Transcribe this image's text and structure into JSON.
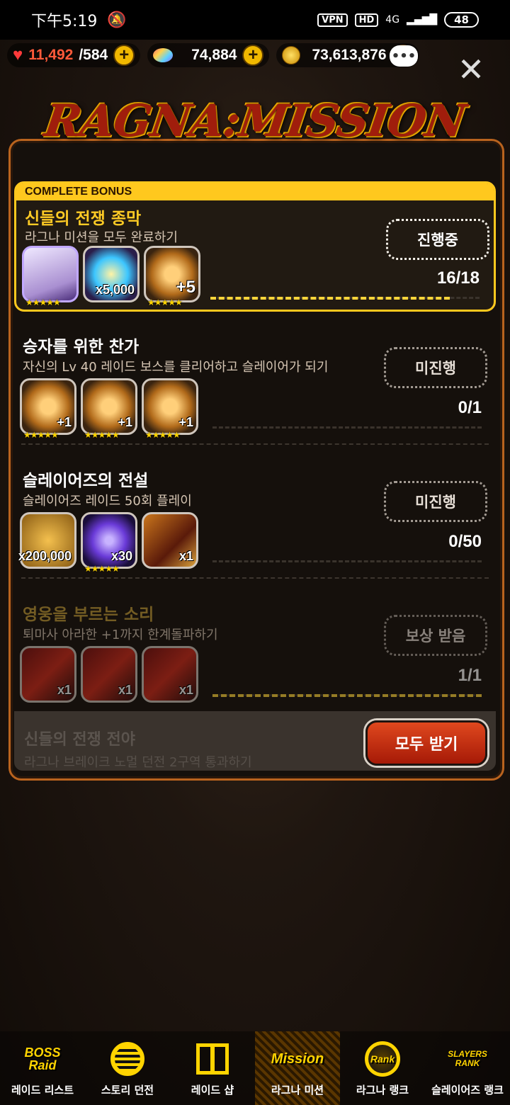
{
  "status_bar": {
    "time": "下午5:19",
    "vpn": "VPN",
    "hd": "HD",
    "network": "4G",
    "battery": "48"
  },
  "currencies": {
    "stamina": "11,492",
    "stamina_max": "/584",
    "gems": "74,884",
    "gold": "73,613,876"
  },
  "header": {
    "logo_text": "RAGNA:MISSION"
  },
  "bonus": {
    "header": "COMPLETE BONUS",
    "title": "신들의 전쟁 종막",
    "desc": "라그나 미션을 모두 완료하기",
    "state": "진행중",
    "progress_text": "16/18",
    "progress": 0.89,
    "rewards": [
      {
        "type": "character-card",
        "qty": "",
        "stars": "★★★★★"
      },
      {
        "type": "rainbow-gem",
        "qty": "x5,000",
        "stars": ""
      },
      {
        "type": "bronze-medal",
        "qty": "+5",
        "stars": "★★★★★"
      }
    ]
  },
  "missions": [
    {
      "title": "승자를 위한 찬가",
      "desc": "자신의 Lv 40 레이드 보스를 클리어하고 슬레이어가 되기",
      "state": "미진행",
      "progress_text": "0/1",
      "progress": 0,
      "rewards": [
        {
          "type": "bronze-medal",
          "qty": "+1",
          "stars": "★★★★★"
        },
        {
          "type": "bronze-medal",
          "qty": "+1",
          "stars": "★★★★★"
        },
        {
          "type": "bronze-medal",
          "qty": "+1",
          "stars": "★★★★★"
        }
      ]
    },
    {
      "title": "슬레이어즈의 전설",
      "desc": "슬레이어즈 레이드 50회 플레이",
      "state": "미진행",
      "progress_text": "0/50",
      "progress": 0,
      "rewards": [
        {
          "type": "gold-coins",
          "qty": "x200,000",
          "stars": ""
        },
        {
          "type": "purple-crystal",
          "qty": "x30",
          "stars": "★★★★★"
        },
        {
          "type": "ticket",
          "qty": "x1",
          "stars": ""
        }
      ]
    },
    {
      "title": "영웅을 부르는 소리",
      "desc": "퇴마사 아라한 +1까지 한계돌파하기",
      "state": "보상 받음",
      "progress_text": "1/1",
      "progress": 1,
      "rewards": [
        {
          "type": "red-ticket",
          "qty": "x1",
          "stars": ""
        },
        {
          "type": "red-ticket",
          "qty": "x1",
          "stars": ""
        },
        {
          "type": "red-ticket",
          "qty": "x1",
          "stars": ""
        }
      ]
    }
  ],
  "peek": {
    "title": "신들의 전쟁 전야",
    "desc": "라그나 브레이크 노멀 던전 2구역 통과하기"
  },
  "claim_all_label": "모두 받기",
  "nav": [
    {
      "label": "레이드 리스트",
      "icon": "boss-raid-icon",
      "icon_text": "BOSS Raid"
    },
    {
      "label": "스토리 던전",
      "icon": "story-dungeon-icon",
      "icon_text": ""
    },
    {
      "label": "레이드 샵",
      "icon": "gift-icon",
      "icon_text": ""
    },
    {
      "label": "라그나 미션",
      "icon": "mission-star-icon",
      "icon_text": "Mission"
    },
    {
      "label": "라그나 랭크",
      "icon": "rank-globe-icon",
      "icon_text": "Rank"
    },
    {
      "label": "슬레이어즈 랭크",
      "icon": "slayers-rank-icon",
      "icon_text": "SLAYERS RANK"
    }
  ],
  "colors": {
    "accent": "#ffc81e",
    "panel_border": "#b9631e",
    "claim_button": "#c42a10"
  }
}
